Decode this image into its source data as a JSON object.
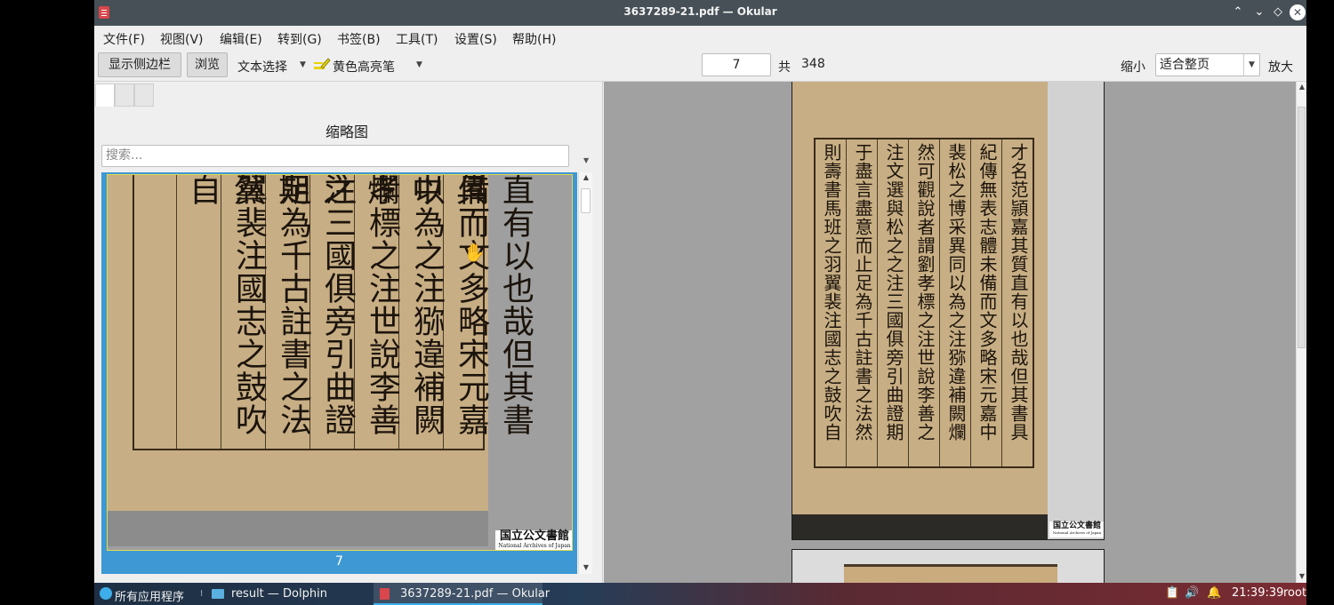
{
  "window": {
    "title": "3637289-21.pdf — Okular",
    "controls": {
      "keep_above": "⌃",
      "minimize": "⌄",
      "maximize": "◇",
      "close": "✕"
    }
  },
  "menubar": [
    "文件(F)",
    "视图(V)",
    "编辑(E)",
    "转到(G)",
    "书签(B)",
    "工具(T)",
    "设置(S)",
    "帮助(H)"
  ],
  "toolbar": {
    "show_sidebar": "显示侧边栏",
    "browse": "浏览",
    "text_select": "文本选择",
    "highlighter": "黄色高亮笔",
    "page_current": "7",
    "page_of": "共",
    "page_total": "348",
    "zoom_out": "缩小",
    "zoom_mode": "适合整页",
    "zoom_in": "放大"
  },
  "sidebar": {
    "title": "缩略图",
    "search_placeholder": "搜索...",
    "thumbnails": [
      {
        "page_label": "7",
        "selected": true
      }
    ]
  },
  "document_text": {
    "thumb_columns": [
      "直有以也哉但其書具",
      "備而文多略宋元嘉中",
      "以為之注猕違補闕爛",
      "孝標之注世說李善之",
      "注三國俱旁引曲證期",
      "足為千古註書之法然",
      "翼裴注國志之鼓吹自"
    ],
    "page_columns": [
      "才名范頴嘉其質直有以也哉但其書具",
      "紀傳無表志體未備而文多略宋元嘉中",
      "裴松之博采異同以為之注猕違補闕爛",
      "然可觀說者謂劉孝標之注世說李善之",
      "注文選與松之之注三國俱旁引曲證期",
      "于盡言盡意而止足為千古註書之法然",
      "則壽書馬班之羽翼裴注國志之鼓吹自"
    ],
    "seal_main": "国立公文書館",
    "seal_sub": "National Archives of Japan"
  },
  "taskbar": {
    "launcher": "所有应用程序",
    "tasks": [
      {
        "label": "result — Dolphin"
      },
      {
        "label": "3637289-21.pdf — Okular",
        "active": true
      }
    ],
    "clock": "21:39:39",
    "user": "root"
  },
  "colors": {
    "titlebar": "#475057",
    "selection": "#3d98d4",
    "paper": "#c7ae84"
  }
}
